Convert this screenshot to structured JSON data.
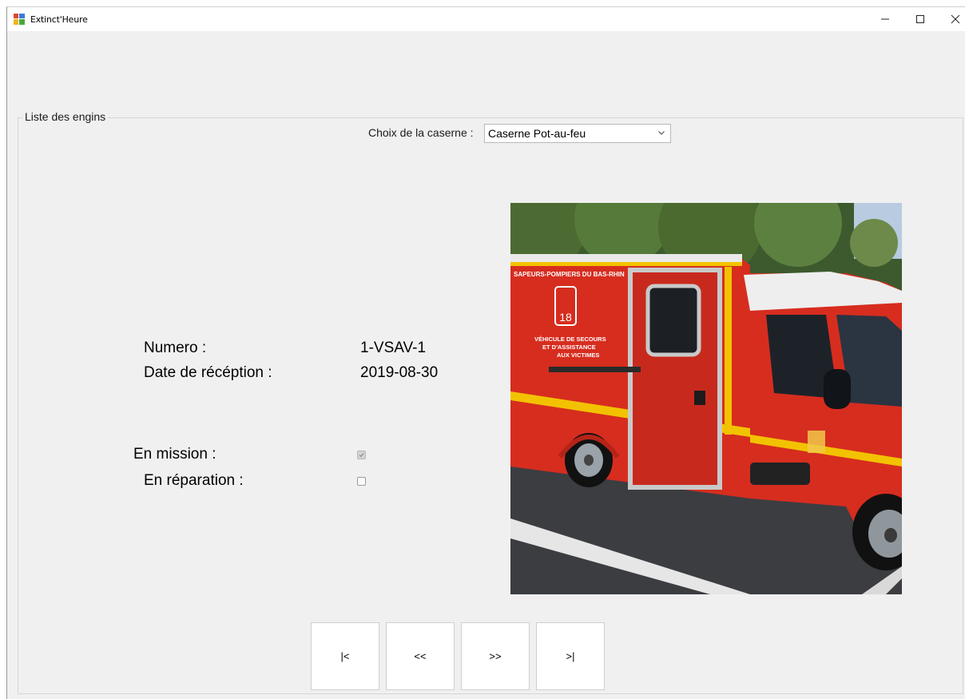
{
  "window": {
    "title": "Extinct'Heure",
    "icon": "app-windows-icon"
  },
  "group": {
    "title": "Liste des engins"
  },
  "caserne": {
    "label": "Choix de la caserne :",
    "selected": "Caserne Pot-au-feu"
  },
  "vehicle": {
    "numero_label": "Numero :",
    "numero_value": "1-VSAV-1",
    "date_label": "Date de récéption :",
    "date_value": "2019-08-30",
    "mission_label": "En mission :",
    "mission_checked": true,
    "reparation_label": "En réparation :",
    "reparation_checked": false,
    "photo_text": {
      "line1": "SAPEURS-POMPIERS DU BAS-RHIN",
      "line2": "VÉHICULE DE SECOURS",
      "line3": "ET D'ASSISTANCE",
      "line4": "AUX VICTIMES",
      "badge": "18"
    }
  },
  "navigation": {
    "first": "|<",
    "prev": "<<",
    "next": ">>",
    "last": ">|"
  },
  "colors": {
    "window_bg": "#f0f0f0",
    "truck_red": "#d62d1f",
    "truck_yellow": "#f2c200"
  }
}
